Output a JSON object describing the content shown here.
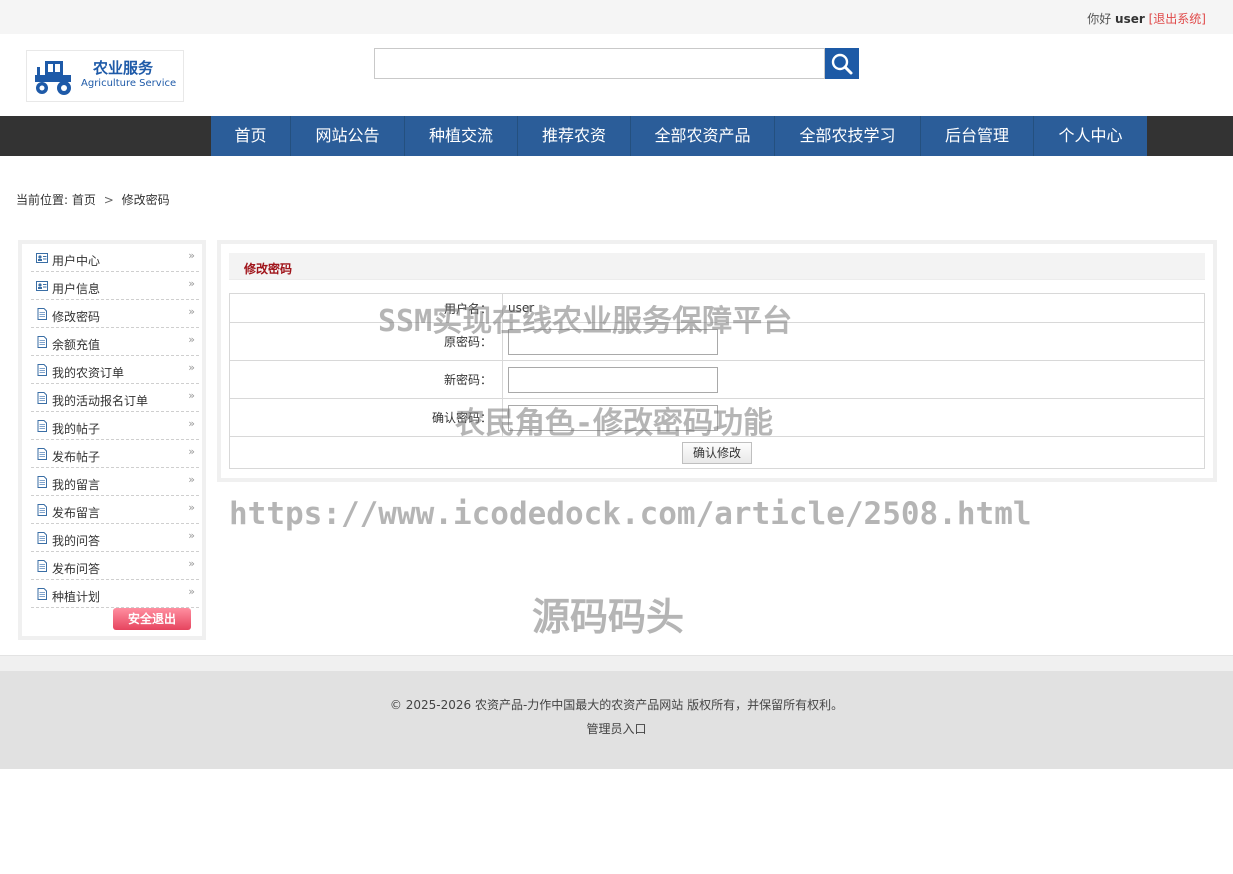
{
  "topbar": {
    "greeting": "你好",
    "username": "user",
    "logout": "[退出系统]"
  },
  "logo": {
    "title_cn": "农业服务",
    "title_en": "Agriculture Service"
  },
  "search": {
    "value": "",
    "placeholder": ""
  },
  "nav": {
    "items": [
      "首页",
      "网站公告",
      "种植交流",
      "推荐农资",
      "全部农资产品",
      "全部农技学习",
      "后台管理",
      "个人中心"
    ]
  },
  "breadcrumb": {
    "prefix": "当前位置:",
    "home": "首页",
    "separator": ">",
    "current": "修改密码"
  },
  "sidebar": {
    "items": [
      {
        "label": "用户中心",
        "icon": "user-card-icon"
      },
      {
        "label": "用户信息",
        "icon": "user-card-icon"
      },
      {
        "label": "修改密码",
        "icon": "document-icon"
      },
      {
        "label": "余额充值",
        "icon": "document-icon"
      },
      {
        "label": "我的农资订单",
        "icon": "document-icon"
      },
      {
        "label": "我的活动报名订单",
        "icon": "document-icon"
      },
      {
        "label": "我的帖子",
        "icon": "document-icon"
      },
      {
        "label": "发布帖子",
        "icon": "document-icon"
      },
      {
        "label": "我的留言",
        "icon": "document-icon"
      },
      {
        "label": "发布留言",
        "icon": "document-icon"
      },
      {
        "label": "我的问答",
        "icon": "document-icon"
      },
      {
        "label": "发布问答",
        "icon": "document-icon"
      },
      {
        "label": "种植计划",
        "icon": "document-icon"
      }
    ],
    "exit_label": "安全退出"
  },
  "panel": {
    "title": "修改密码",
    "username_label": "用户名：",
    "username_value": "user",
    "old_password_label": "原密码：",
    "new_password_label": "新密码：",
    "confirm_password_label": "确认密码：",
    "submit_label": "确认修改"
  },
  "watermark": {
    "line1": "SSM实现在线农业服务保障平台",
    "line2": "农民角色-修改密码功能",
    "line3": "https://www.icodedock.com/article/2508.html",
    "line4": "源码码头"
  },
  "footer": {
    "copyright": "© 2025-2026 农资产品-力作中国最大的农资产品网站 版权所有，并保留所有权利。",
    "admin_link": "管理员入口"
  },
  "colors": {
    "nav_bg": "#2b5d99",
    "nav_bar": "#333333",
    "accent_blue": "#1d5aa6",
    "title_red": "#a0151b",
    "exit_button": "#e6445e"
  }
}
